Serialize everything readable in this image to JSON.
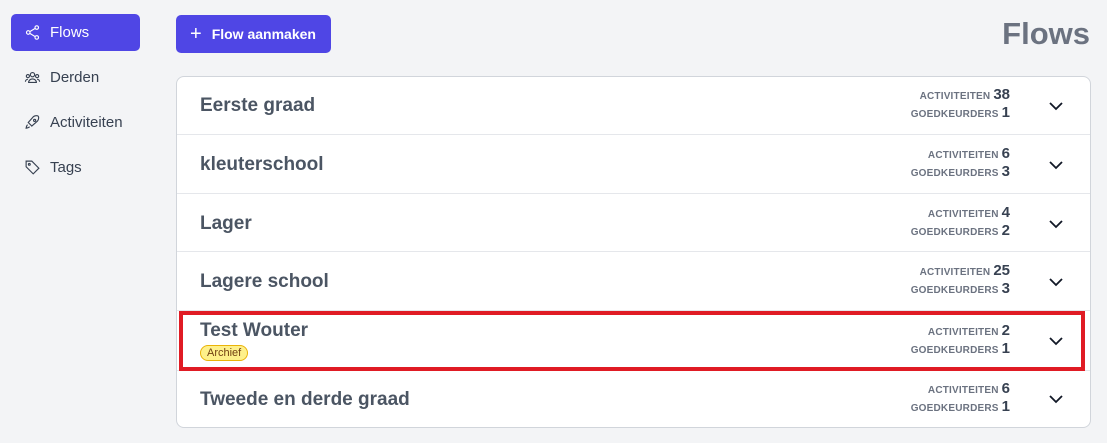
{
  "sidebar": {
    "items": [
      {
        "label": "Flows",
        "icon": "share-icon",
        "active": true
      },
      {
        "label": "Derden",
        "icon": "users-icon",
        "active": false
      },
      {
        "label": "Activiteiten",
        "icon": "rocket-icon",
        "active": false
      },
      {
        "label": "Tags",
        "icon": "tag-icon",
        "active": false
      }
    ]
  },
  "toolbar": {
    "create_label": "Flow aanmaken",
    "create_icon": "plus-icon"
  },
  "page": {
    "title": "Flows"
  },
  "labels": {
    "activities": "ACTIVITEITEN",
    "approvers": "GOEDKEURDERS"
  },
  "flows": [
    {
      "name": "Eerste graad",
      "activities": "38",
      "approvers": "1",
      "badge": ""
    },
    {
      "name": "kleuterschool",
      "activities": "6",
      "approvers": "3",
      "badge": ""
    },
    {
      "name": "Lager",
      "activities": "4",
      "approvers": "2",
      "badge": ""
    },
    {
      "name": "Lagere school",
      "activities": "25",
      "approvers": "3",
      "badge": ""
    },
    {
      "name": "Test Wouter",
      "activities": "2",
      "approvers": "1",
      "badge": "Archief"
    },
    {
      "name": "Tweede en derde graad",
      "activities": "6",
      "approvers": "1",
      "badge": ""
    }
  ],
  "colors": {
    "accent": "#4f46e5",
    "highlight": "#e01b24",
    "badge_bg": "#fef08a"
  }
}
